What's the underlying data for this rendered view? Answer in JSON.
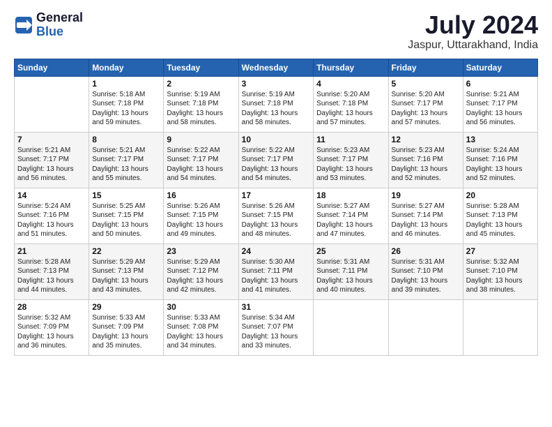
{
  "header": {
    "logo_general": "General",
    "logo_blue": "Blue",
    "month_year": "July 2024",
    "location": "Jaspur, Uttarakhand, India"
  },
  "columns": [
    "Sunday",
    "Monday",
    "Tuesday",
    "Wednesday",
    "Thursday",
    "Friday",
    "Saturday"
  ],
  "weeks": [
    [
      {
        "num": "",
        "text": ""
      },
      {
        "num": "1",
        "text": "Sunrise: 5:18 AM\nSunset: 7:18 PM\nDaylight: 13 hours\nand 59 minutes."
      },
      {
        "num": "2",
        "text": "Sunrise: 5:19 AM\nSunset: 7:18 PM\nDaylight: 13 hours\nand 58 minutes."
      },
      {
        "num": "3",
        "text": "Sunrise: 5:19 AM\nSunset: 7:18 PM\nDaylight: 13 hours\nand 58 minutes."
      },
      {
        "num": "4",
        "text": "Sunrise: 5:20 AM\nSunset: 7:18 PM\nDaylight: 13 hours\nand 57 minutes."
      },
      {
        "num": "5",
        "text": "Sunrise: 5:20 AM\nSunset: 7:17 PM\nDaylight: 13 hours\nand 57 minutes."
      },
      {
        "num": "6",
        "text": "Sunrise: 5:21 AM\nSunset: 7:17 PM\nDaylight: 13 hours\nand 56 minutes."
      }
    ],
    [
      {
        "num": "7",
        "text": "Sunrise: 5:21 AM\nSunset: 7:17 PM\nDaylight: 13 hours\nand 56 minutes."
      },
      {
        "num": "8",
        "text": "Sunrise: 5:21 AM\nSunset: 7:17 PM\nDaylight: 13 hours\nand 55 minutes."
      },
      {
        "num": "9",
        "text": "Sunrise: 5:22 AM\nSunset: 7:17 PM\nDaylight: 13 hours\nand 54 minutes."
      },
      {
        "num": "10",
        "text": "Sunrise: 5:22 AM\nSunset: 7:17 PM\nDaylight: 13 hours\nand 54 minutes."
      },
      {
        "num": "11",
        "text": "Sunrise: 5:23 AM\nSunset: 7:17 PM\nDaylight: 13 hours\nand 53 minutes."
      },
      {
        "num": "12",
        "text": "Sunrise: 5:23 AM\nSunset: 7:16 PM\nDaylight: 13 hours\nand 52 minutes."
      },
      {
        "num": "13",
        "text": "Sunrise: 5:24 AM\nSunset: 7:16 PM\nDaylight: 13 hours\nand 52 minutes."
      }
    ],
    [
      {
        "num": "14",
        "text": "Sunrise: 5:24 AM\nSunset: 7:16 PM\nDaylight: 13 hours\nand 51 minutes."
      },
      {
        "num": "15",
        "text": "Sunrise: 5:25 AM\nSunset: 7:15 PM\nDaylight: 13 hours\nand 50 minutes."
      },
      {
        "num": "16",
        "text": "Sunrise: 5:26 AM\nSunset: 7:15 PM\nDaylight: 13 hours\nand 49 minutes."
      },
      {
        "num": "17",
        "text": "Sunrise: 5:26 AM\nSunset: 7:15 PM\nDaylight: 13 hours\nand 48 minutes."
      },
      {
        "num": "18",
        "text": "Sunrise: 5:27 AM\nSunset: 7:14 PM\nDaylight: 13 hours\nand 47 minutes."
      },
      {
        "num": "19",
        "text": "Sunrise: 5:27 AM\nSunset: 7:14 PM\nDaylight: 13 hours\nand 46 minutes."
      },
      {
        "num": "20",
        "text": "Sunrise: 5:28 AM\nSunset: 7:13 PM\nDaylight: 13 hours\nand 45 minutes."
      }
    ],
    [
      {
        "num": "21",
        "text": "Sunrise: 5:28 AM\nSunset: 7:13 PM\nDaylight: 13 hours\nand 44 minutes."
      },
      {
        "num": "22",
        "text": "Sunrise: 5:29 AM\nSunset: 7:13 PM\nDaylight: 13 hours\nand 43 minutes."
      },
      {
        "num": "23",
        "text": "Sunrise: 5:29 AM\nSunset: 7:12 PM\nDaylight: 13 hours\nand 42 minutes."
      },
      {
        "num": "24",
        "text": "Sunrise: 5:30 AM\nSunset: 7:11 PM\nDaylight: 13 hours\nand 41 minutes."
      },
      {
        "num": "25",
        "text": "Sunrise: 5:31 AM\nSunset: 7:11 PM\nDaylight: 13 hours\nand 40 minutes."
      },
      {
        "num": "26",
        "text": "Sunrise: 5:31 AM\nSunset: 7:10 PM\nDaylight: 13 hours\nand 39 minutes."
      },
      {
        "num": "27",
        "text": "Sunrise: 5:32 AM\nSunset: 7:10 PM\nDaylight: 13 hours\nand 38 minutes."
      }
    ],
    [
      {
        "num": "28",
        "text": "Sunrise: 5:32 AM\nSunset: 7:09 PM\nDaylight: 13 hours\nand 36 minutes."
      },
      {
        "num": "29",
        "text": "Sunrise: 5:33 AM\nSunset: 7:09 PM\nDaylight: 13 hours\nand 35 minutes."
      },
      {
        "num": "30",
        "text": "Sunrise: 5:33 AM\nSunset: 7:08 PM\nDaylight: 13 hours\nand 34 minutes."
      },
      {
        "num": "31",
        "text": "Sunrise: 5:34 AM\nSunset: 7:07 PM\nDaylight: 13 hours\nand 33 minutes."
      },
      {
        "num": "",
        "text": ""
      },
      {
        "num": "",
        "text": ""
      },
      {
        "num": "",
        "text": ""
      }
    ]
  ]
}
